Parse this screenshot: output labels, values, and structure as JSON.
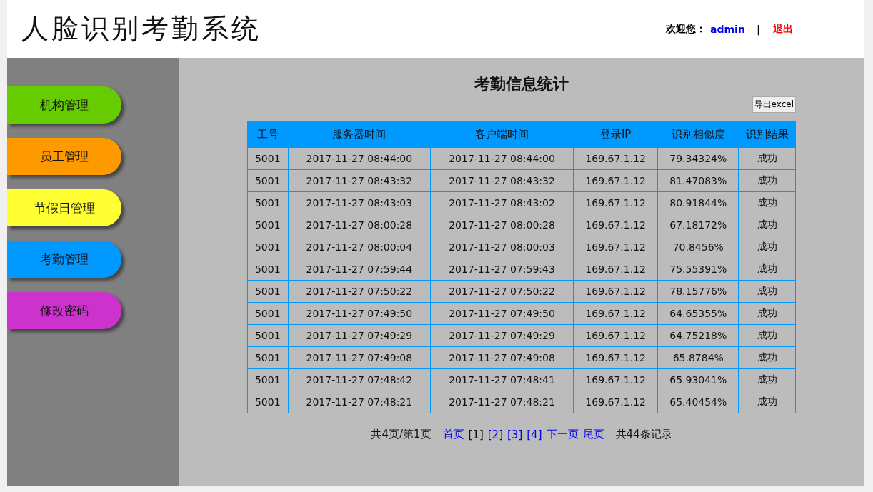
{
  "header": {
    "title": "人脸识别考勤系统",
    "welcome": "欢迎您：",
    "user": "admin",
    "separator": "|",
    "logout": "退出"
  },
  "sidebar": {
    "items": [
      {
        "label": "机构管理",
        "color": "#66cc00"
      },
      {
        "label": "员工管理",
        "color": "#ff9900"
      },
      {
        "label": "节假日管理",
        "color": "#ffff33"
      },
      {
        "label": "考勤管理",
        "color": "#0099ff"
      },
      {
        "label": "修改密码",
        "color": "#cc33cc"
      }
    ]
  },
  "page_title": "考勤信息统计",
  "export_button": "导出excel",
  "table": {
    "columns": [
      "工号",
      "服务器时间",
      "客户端时间",
      "登录IP",
      "识别相似度",
      "识别结果"
    ],
    "rows": [
      [
        "5001",
        "2017-11-27 08:44:00",
        "2017-11-27 08:44:00",
        "169.67.1.12",
        "79.34324%",
        "成功"
      ],
      [
        "5001",
        "2017-11-27 08:43:32",
        "2017-11-27 08:43:32",
        "169.67.1.12",
        "81.47083%",
        "成功"
      ],
      [
        "5001",
        "2017-11-27 08:43:03",
        "2017-11-27 08:43:02",
        "169.67.1.12",
        "80.91844%",
        "成功"
      ],
      [
        "5001",
        "2017-11-27 08:00:28",
        "2017-11-27 08:00:28",
        "169.67.1.12",
        "67.18172%",
        "成功"
      ],
      [
        "5001",
        "2017-11-27 08:00:04",
        "2017-11-27 08:00:03",
        "169.67.1.12",
        "70.8456%",
        "成功"
      ],
      [
        "5001",
        "2017-11-27 07:59:44",
        "2017-11-27 07:59:43",
        "169.67.1.12",
        "75.55391%",
        "成功"
      ],
      [
        "5001",
        "2017-11-27 07:50:22",
        "2017-11-27 07:50:22",
        "169.67.1.12",
        "78.15776%",
        "成功"
      ],
      [
        "5001",
        "2017-11-27 07:49:50",
        "2017-11-27 07:49:50",
        "169.67.1.12",
        "64.65355%",
        "成功"
      ],
      [
        "5001",
        "2017-11-27 07:49:29",
        "2017-11-27 07:49:29",
        "169.67.1.12",
        "64.75218%",
        "成功"
      ],
      [
        "5001",
        "2017-11-27 07:49:08",
        "2017-11-27 07:49:08",
        "169.67.1.12",
        "65.8784%",
        "成功"
      ],
      [
        "5001",
        "2017-11-27 07:48:42",
        "2017-11-27 07:48:41",
        "169.67.1.12",
        "65.93041%",
        "成功"
      ],
      [
        "5001",
        "2017-11-27 07:48:21",
        "2017-11-27 07:48:21",
        "169.67.1.12",
        "65.40454%",
        "成功"
      ]
    ]
  },
  "pagination": {
    "summary": "共4页/第1页",
    "links": [
      {
        "label": "首页",
        "selected": false
      },
      {
        "label": "[1]",
        "selected": true
      },
      {
        "label": "[2]",
        "selected": false
      },
      {
        "label": "[3]",
        "selected": false
      },
      {
        "label": "[4]",
        "selected": false
      },
      {
        "label": "下一页",
        "selected": false
      },
      {
        "label": "尾页",
        "selected": false
      }
    ],
    "total": "共44条记录"
  }
}
